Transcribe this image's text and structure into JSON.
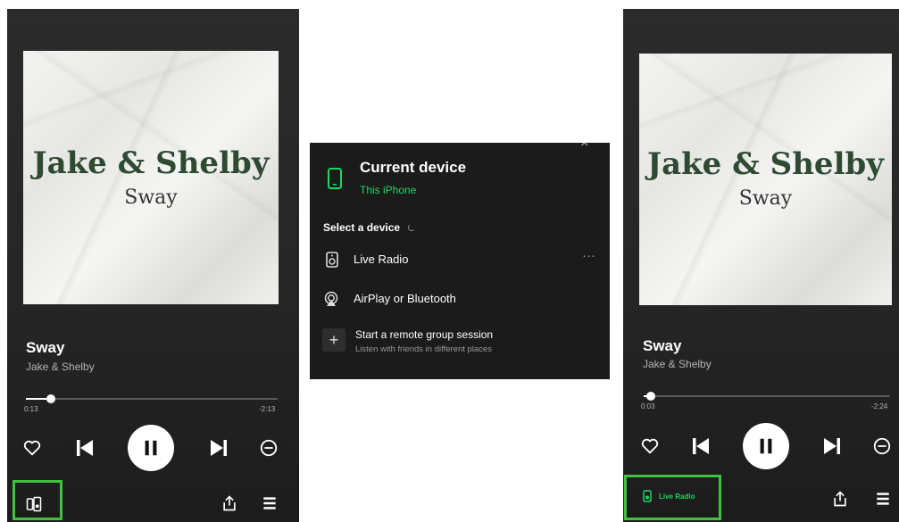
{
  "left_player": {
    "album_art": {
      "artist_text": "Jake & Shelby",
      "track_text": "Sway"
    },
    "track_title": "Sway",
    "artist": "Jake & Shelby",
    "elapsed": "0:13",
    "remaining": "-2:13",
    "progress": 0.1
  },
  "device_picker": {
    "header": "Current device",
    "current_device": "This iPhone",
    "section_label": "Select a device",
    "devices": [
      {
        "label": "Live Radio",
        "icon": "speaker-icon"
      },
      {
        "label": "AirPlay or Bluetooth",
        "icon": "airplay-icon"
      }
    ],
    "group_session": {
      "title": "Start a remote group session",
      "subtitle": "Listen with friends in different places"
    },
    "more_label": "···"
  },
  "right_player": {
    "album_art": {
      "artist_text": "Jake & Shelby",
      "track_text": "Sway"
    },
    "track_title": "Sway",
    "artist": "Jake & Shelby",
    "elapsed": "0:03",
    "remaining": "-2:24",
    "progress": 0.03,
    "connected_device": "Live Radio"
  },
  "colors": {
    "accent": "#1ed760",
    "highlight_box": "#3fc23f",
    "background": "#262626"
  }
}
